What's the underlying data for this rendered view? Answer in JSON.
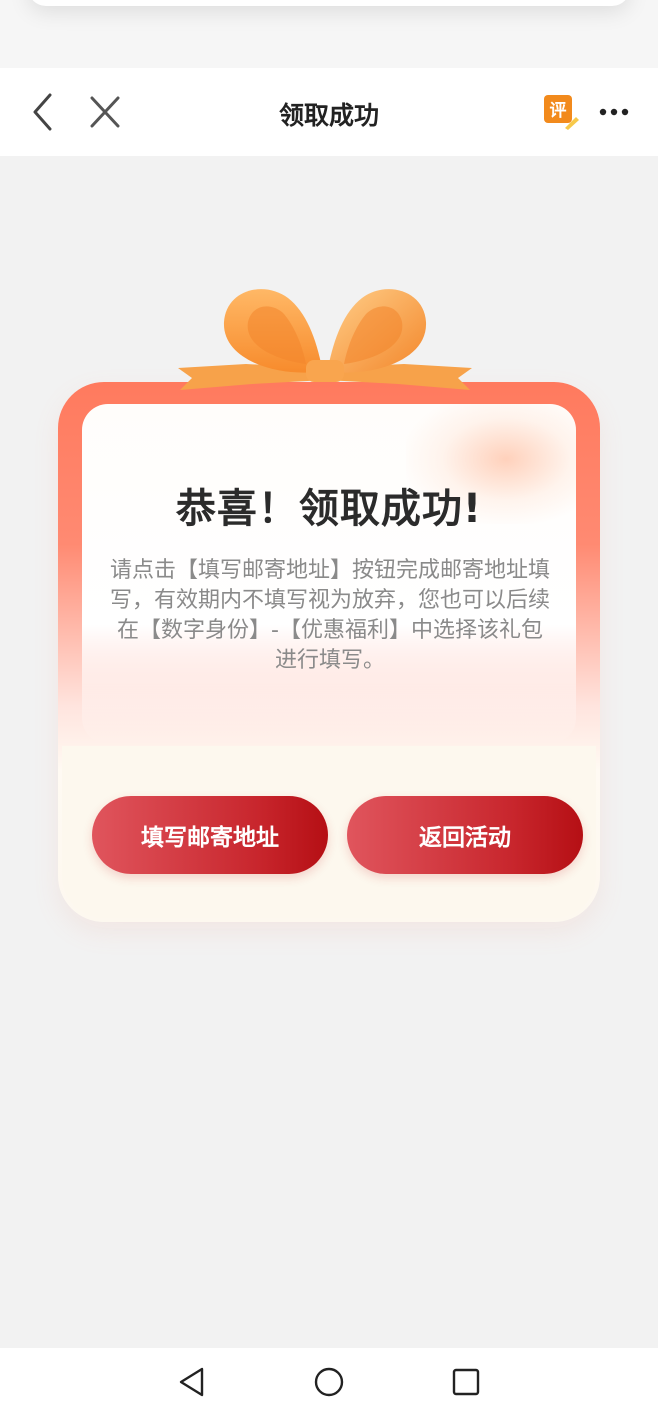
{
  "nav": {
    "title": "领取成功",
    "review_icon_text": "评",
    "icons": [
      "back-arrow-icon",
      "close-icon",
      "review-icon",
      "more-icon"
    ]
  },
  "card": {
    "title": "恭喜！领取成功!",
    "description": "请点击【填写邮寄地址】按钮完成邮寄地址填写，有效期内不填写视为放弃，您也可以后续在【数字身份】-【优惠福利】中选择该礼包进行填写。",
    "fill_address_button": "填写邮寄地址",
    "back_button": "返回活动"
  },
  "system_nav": {
    "icons": [
      "triangle-back-icon",
      "circle-home-icon",
      "square-recents-icon"
    ]
  },
  "colors": {
    "button_start": "#e0555d",
    "button_end": "#b50f14",
    "card_top": "#ff7a5e",
    "ribbon": "#f99c45"
  }
}
